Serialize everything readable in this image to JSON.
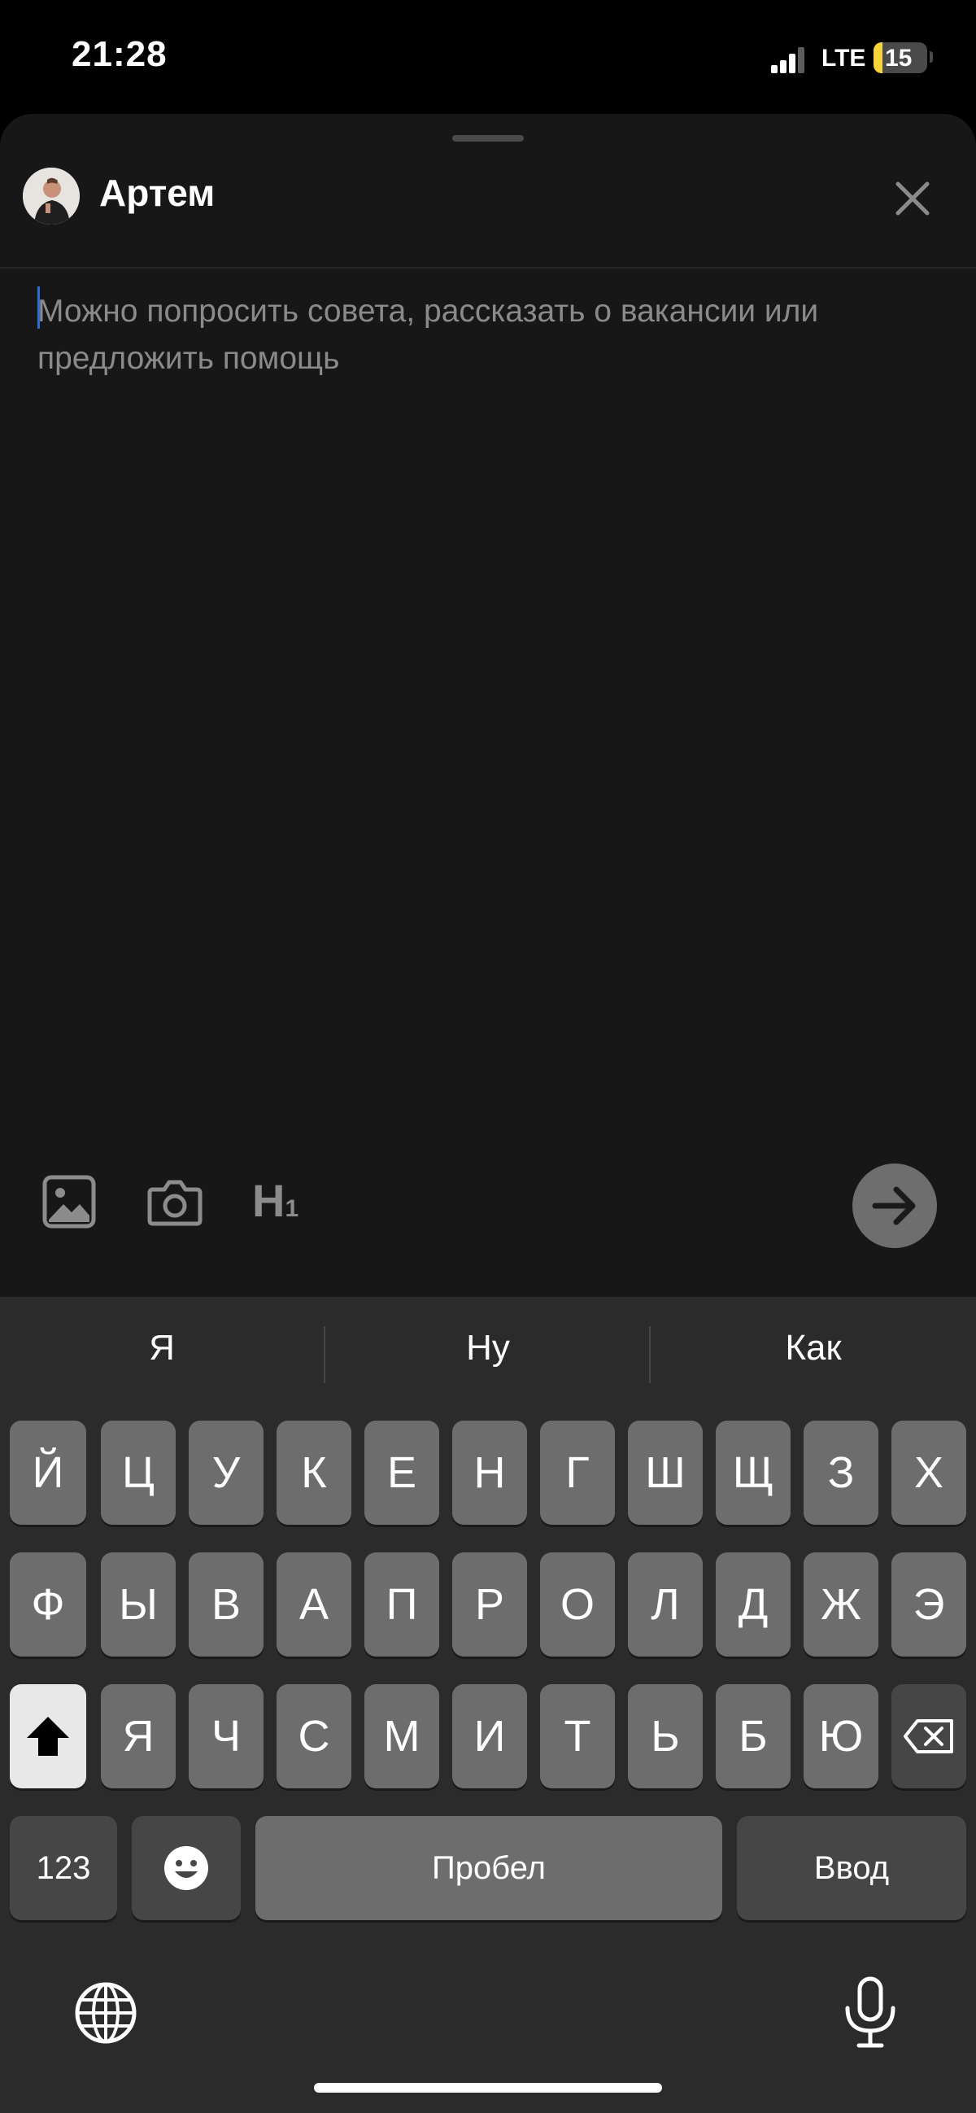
{
  "status_bar": {
    "time": "21:28",
    "network": "LTE",
    "battery": "15",
    "battery_color": "#f7d43a"
  },
  "composer": {
    "user_name": "Артем",
    "placeholder": "Можно попросить совета, рассказать о вакансии или предложить помощь",
    "toolbar": [
      "image-icon",
      "camera-icon",
      "heading-icon"
    ],
    "heading_label": "H",
    "heading_sub": "1"
  },
  "keyboard": {
    "suggestions": [
      "Я",
      "Ну",
      "Как"
    ],
    "row1": [
      "Й",
      "Ц",
      "У",
      "К",
      "Е",
      "Н",
      "Г",
      "Ш",
      "Щ",
      "З",
      "Х"
    ],
    "row2": [
      "Ф",
      "Ы",
      "В",
      "А",
      "П",
      "Р",
      "О",
      "Л",
      "Д",
      "Ж",
      "Э"
    ],
    "row3": [
      "Я",
      "Ч",
      "С",
      "М",
      "И",
      "Т",
      "Ь",
      "Б",
      "Ю"
    ],
    "numbers_label": "123",
    "space_label": "Пробел",
    "return_label": "Ввод"
  }
}
